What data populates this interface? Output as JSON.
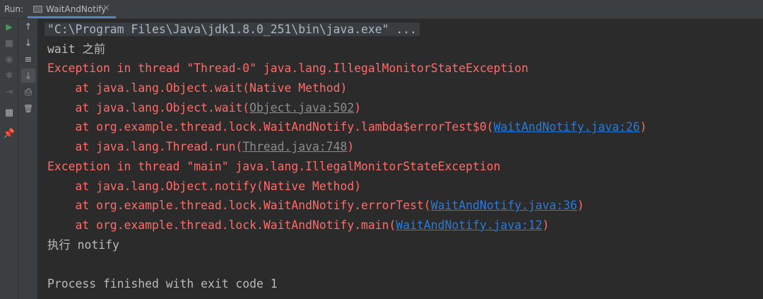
{
  "toolbar": {
    "run_label": "Run:"
  },
  "tab": {
    "title": "WaitAndNotify",
    "close": "×"
  },
  "gutter": {
    "rerun_icon": "▶",
    "stop_icon": "■",
    "camera_icon": "◉",
    "debug_icon": "✱",
    "restore_icon": "⇥",
    "up_icon": "↑",
    "down_icon": "↓",
    "soft_wrap_icon": "≡",
    "scroll_end_icon": "⤓",
    "print_icon": "⎙",
    "trash_icon": "🗑",
    "layout_icon": "▦",
    "pin_icon": "📌"
  },
  "console": {
    "command": "\"C:\\Program Files\\Java\\jdk1.8.0_251\\bin\\java.exe\" ...",
    "wait_before": "wait 之前",
    "exc1": "Exception in thread \"Thread-0\" java.lang.IllegalMonitorStateException",
    "t1_l1": "    at java.lang.Object.wait(Native Method)",
    "t1_l2_pre": "    at java.lang.Object.wait(",
    "t1_l2_link": "Object.java:502",
    "t1_l2_post": ")",
    "t1_l3_pre": "    at org.example.thread.lock.WaitAndNotify.lambda$errorTest$0(",
    "t1_l3_link": "WaitAndNotify.java:26",
    "t1_l3_post": ")",
    "t1_l4_pre": "    at java.lang.Thread.run(",
    "t1_l4_link": "Thread.java:748",
    "t1_l4_post": ")",
    "exc2": "Exception in thread \"main\" java.lang.IllegalMonitorStateException",
    "t2_l1": "    at java.lang.Object.notify(Native Method)",
    "t2_l2_pre": "    at org.example.thread.lock.WaitAndNotify.errorTest(",
    "t2_l2_link": "WaitAndNotify.java:36",
    "t2_l2_post": ")",
    "t2_l3_pre": "    at org.example.thread.lock.WaitAndNotify.main(",
    "t2_l3_link": "WaitAndNotify.java:12",
    "t2_l3_post": ")",
    "exec_notify": "执行 notify",
    "blank": "",
    "finished": "Process finished with exit code 1"
  }
}
